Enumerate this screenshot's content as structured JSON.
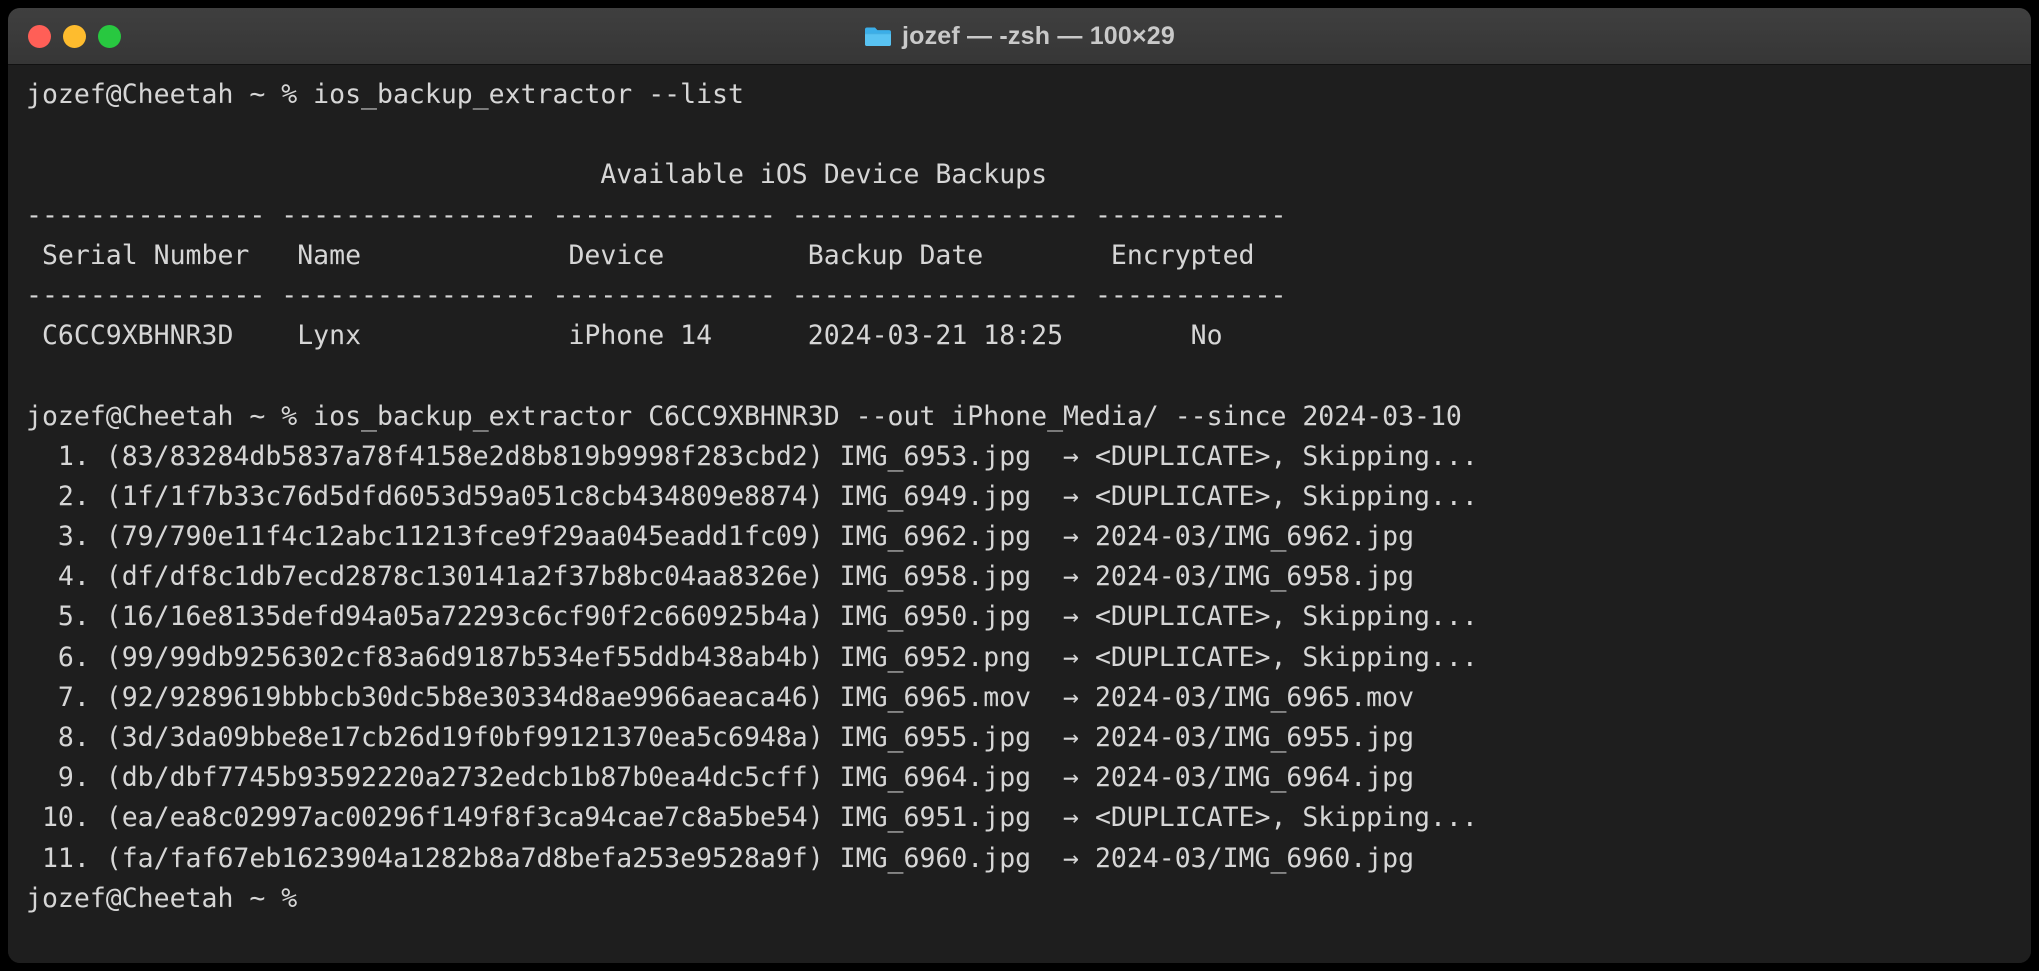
{
  "window": {
    "title": "jozef — -zsh — 100×29",
    "icon": "folder-icon",
    "traffic_lights": [
      {
        "name": "close-button",
        "color": "#FF5F57"
      },
      {
        "name": "minimize-button",
        "color": "#FEBC2E"
      },
      {
        "name": "zoom-button",
        "color": "#28C840"
      }
    ]
  },
  "theme": {
    "titlebar_bg": "#3A3A3A",
    "terminal_bg": "#1E1E1E",
    "terminal_fg": "#D6D6D6",
    "title_fg": "#C9C9C9"
  },
  "terminal": {
    "prompt": "jozef@Cheetah ~ % ",
    "command_1": "ios_backup_extractor --list",
    "command_2": "ios_backup_extractor C6CC9XBHNR3D --out iPhone_Media/ --since 2024-03-10",
    "final_prompt": "jozef@Cheetah ~ % ",
    "list_title": "Available iOS Device Backups",
    "table": {
      "separator": "--------------- ---------------- -------------- ------------------ ------------",
      "headers": [
        {
          "label": "Serial Number",
          "width": 15
        },
        {
          "label": "Name",
          "width": 16
        },
        {
          "label": "Device",
          "width": 14
        },
        {
          "label": "Backup Date",
          "width": 18
        },
        {
          "label": "Encrypted",
          "width": 12
        }
      ],
      "rows": [
        {
          "serial_number": "C6CC9XBHNR3D",
          "name": "Lynx",
          "device": "iPhone 14",
          "backup_date": "2024-03-21 18:25",
          "encrypted": "No"
        }
      ]
    },
    "extraction": {
      "arrow": "→",
      "duplicate_text": "<DUPLICATE>, Skipping...",
      "items": [
        {
          "index": "1.",
          "hash": "83/83284db5837a78f4158e2d8b819b9998f283cbd2",
          "filename": "IMG_6953.jpg",
          "destination": "<DUPLICATE>, Skipping..."
        },
        {
          "index": "2.",
          "hash": "1f/1f7b33c76d5dfd6053d59a051c8cb434809e8874",
          "filename": "IMG_6949.jpg",
          "destination": "<DUPLICATE>, Skipping..."
        },
        {
          "index": "3.",
          "hash": "79/790e11f4c12abc11213fce9f29aa045eadd1fc09",
          "filename": "IMG_6962.jpg",
          "destination": "2024-03/IMG_6962.jpg"
        },
        {
          "index": "4.",
          "hash": "df/df8c1db7ecd2878c130141a2f37b8bc04aa8326e",
          "filename": "IMG_6958.jpg",
          "destination": "2024-03/IMG_6958.jpg"
        },
        {
          "index": "5.",
          "hash": "16/16e8135defd94a05a72293c6cf90f2c660925b4a",
          "filename": "IMG_6950.jpg",
          "destination": "<DUPLICATE>, Skipping..."
        },
        {
          "index": "6.",
          "hash": "99/99db9256302cf83a6d9187b534ef55ddb438ab4b",
          "filename": "IMG_6952.png",
          "destination": "<DUPLICATE>, Skipping..."
        },
        {
          "index": "7.",
          "hash": "92/9289619bbbcb30dc5b8e30334d8ae9966aeaca46",
          "filename": "IMG_6965.mov",
          "destination": "2024-03/IMG_6965.mov"
        },
        {
          "index": "8.",
          "hash": "3d/3da09bbe8e17cb26d19f0bf99121370ea5c6948a",
          "filename": "IMG_6955.jpg",
          "destination": "2024-03/IMG_6955.jpg"
        },
        {
          "index": "9.",
          "hash": "db/dbf7745b93592220a2732edcb1b87b0ea4dc5cff",
          "filename": "IMG_6964.jpg",
          "destination": "2024-03/IMG_6964.jpg"
        },
        {
          "index": "10.",
          "hash": "ea/ea8c02997ac00296f149f8f3ca94cae7c8a5be54",
          "filename": "IMG_6951.jpg",
          "destination": "<DUPLICATE>, Skipping..."
        },
        {
          "index": "11.",
          "hash": "fa/faf67eb1623904a1282b8a7d8befa253e9528a9f",
          "filename": "IMG_6960.jpg",
          "destination": "2024-03/IMG_6960.jpg"
        }
      ]
    }
  }
}
